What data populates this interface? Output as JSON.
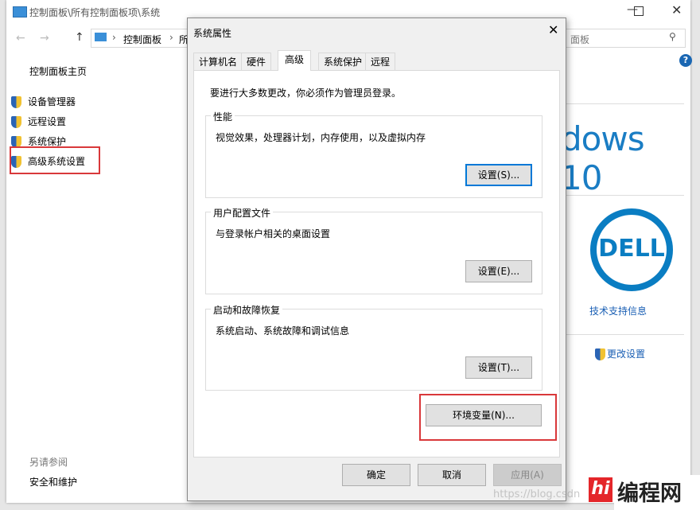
{
  "window": {
    "title": "控制面板\\所有控制面板项\\系统",
    "breadcrumb": [
      "控制面板",
      "所"
    ],
    "search_tail": "面板"
  },
  "sidebar": {
    "home": "控制面板主页",
    "items": [
      "设备管理器",
      "远程设置",
      "系统保护",
      "高级系统设置"
    ],
    "see_also": "另请参阅",
    "see_also_items": [
      "安全和维护"
    ]
  },
  "right": {
    "windows_brand": "dows 10",
    "dell_logo": "DELL",
    "support": "技术支持信息",
    "change_settings": "更改设置"
  },
  "dialog": {
    "title": "系统属性",
    "tabs": [
      "计算机名",
      "硬件",
      "高级",
      "系统保护",
      "远程"
    ],
    "active_tab": "高级",
    "notice": "要进行大多数更改，你必须作为管理员登录。",
    "groups": [
      {
        "label": "性能",
        "desc": "视觉效果，处理器计划，内存使用，以及虚拟内存",
        "button": "设置(S)..."
      },
      {
        "label": "用户配置文件",
        "desc": "与登录帐户相关的桌面设置",
        "button": "设置(E)..."
      },
      {
        "label": "启动和故障恢复",
        "desc": "系统启动、系统故障和调试信息",
        "button": "设置(T)..."
      }
    ],
    "env_button": "环境变量(N)...",
    "ok": "确定",
    "cancel": "取消",
    "apply": "应用(A)"
  },
  "watermark": {
    "url": "https://blog.csdn",
    "brand": "编程网",
    "logo": "hi"
  }
}
